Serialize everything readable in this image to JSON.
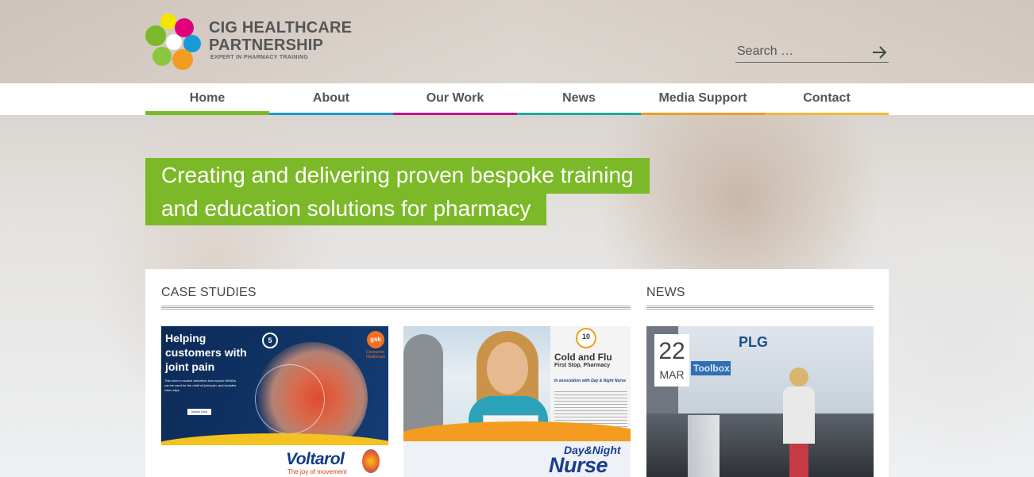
{
  "brand": {
    "title_line1": "CIG HEALTHCARE",
    "title_line2": "PARTNERSHIP",
    "tagline": "EXPERT IN PHARMACY TRAINING",
    "logo_colors": [
      "#7cb928",
      "#f39c1f",
      "#e2007a",
      "#1a9ad6",
      "#f3e600"
    ]
  },
  "search": {
    "placeholder": "Search …",
    "icon": "arrow-right-icon"
  },
  "nav": {
    "items": [
      {
        "label": "Home",
        "color": "#7cb928",
        "active": true
      },
      {
        "label": "About",
        "color": "#1a9ad6",
        "active": false
      },
      {
        "label": "Our Work",
        "color": "#c4168b",
        "active": false
      },
      {
        "label": "News",
        "color": "#1fa7a3",
        "active": false
      },
      {
        "label": "Media Support",
        "color": "#f39c1f",
        "active": false
      },
      {
        "label": "Contact",
        "color": "#f7b733",
        "active": false
      }
    ]
  },
  "hero": {
    "line1": "Creating and delivering proven bespoke training",
    "line2": "and education solutions for pharmacy",
    "accent": "#7cb928"
  },
  "case_studies": {
    "heading": "CASE STUDIES",
    "cards": [
      {
        "headline": "Helping customers with joint pain",
        "badge": "5",
        "partner": "gsk",
        "partner_sub": "Consumer Healthcare",
        "blurb": "This short e-module describes how topical NSAIDs can be used for the relief of joint pain, and includes video clips.",
        "cta": "Watch Now",
        "brand": "Voltarol",
        "brand_tag": "The joy of movement"
      },
      {
        "badge": "10",
        "title": "Cold and Flu",
        "subtitle": "First Stop, Pharmacy",
        "association": "In association with Day & Night Nurse",
        "brand_top": "Day&Night",
        "brand_main": "Nurse"
      }
    ]
  },
  "news": {
    "heading": "NEWS",
    "items": [
      {
        "day": "22",
        "month": "MAR",
        "screen_label_1": "Toolbox",
        "screen_label_2": "PLG"
      }
    ]
  }
}
